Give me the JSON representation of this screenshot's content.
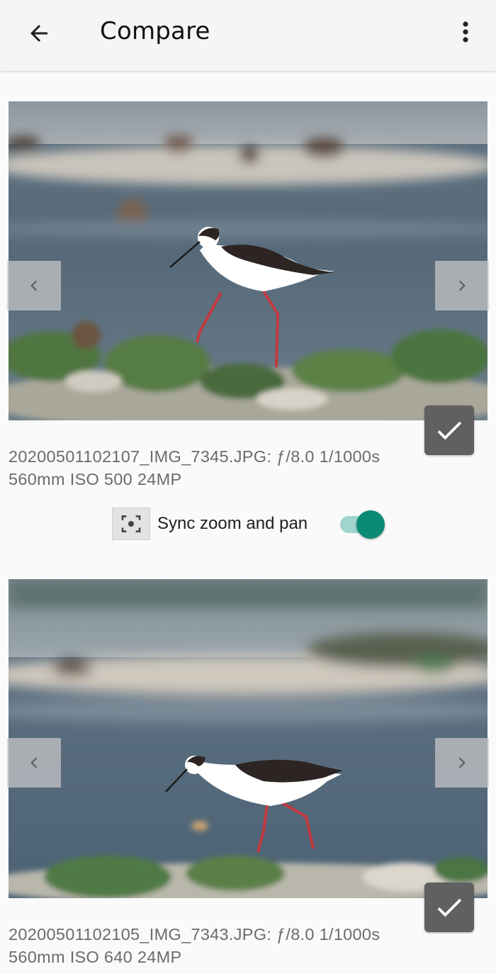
{
  "appbar": {
    "title": "Compare",
    "back_icon": "arrow-back-icon",
    "menu_icon": "more-vert-icon"
  },
  "photos": [
    {
      "line1": "20200501102107_IMG_7345.JPG: ƒ/8.0 1/1000s",
      "line2": "560mm ISO 500 24MP",
      "selected": true
    },
    {
      "line1": "20200501102105_IMG_7343.JPG: ƒ/8.0 1/1000s",
      "line2": "560mm ISO 640 24MP",
      "selected": true
    }
  ],
  "sync": {
    "label": "Sync zoom and pan",
    "enabled": true,
    "icon": "center-focus-icon"
  },
  "colors": {
    "accent": "#0b8a76",
    "accent_track": "#9fd5cc"
  }
}
